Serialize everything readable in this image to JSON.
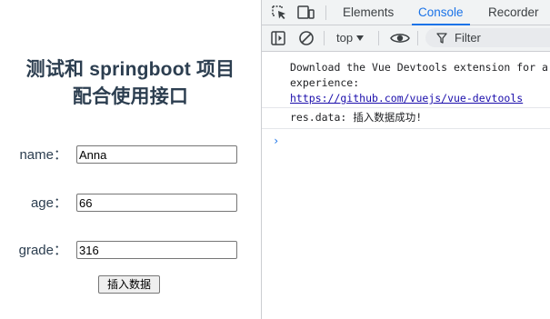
{
  "app": {
    "title_line1": "测试和 springboot 项目",
    "title_line2": "配合使用接口",
    "fields": [
      {
        "label": "name：",
        "value": "Anna"
      },
      {
        "label": "age：",
        "value": "66"
      },
      {
        "label": "grade：",
        "value": "316"
      }
    ],
    "submit_label": "插入数据"
  },
  "devtools": {
    "tabs": [
      {
        "label": "Elements",
        "active": false
      },
      {
        "label": "Console",
        "active": true
      },
      {
        "label": "Recorder",
        "active": false
      }
    ],
    "toolbar": {
      "context": "top",
      "filter_label": "Filter"
    },
    "console": {
      "messages": [
        {
          "line1": "Download the Vue Devtools extension for a",
          "line2": "experience:",
          "link": "https://github.com/vuejs/vue-devtools"
        },
        {
          "text": "res.data: 插入数据成功!"
        }
      ],
      "prompt_symbol": "›"
    },
    "colors": {
      "accent": "#1a73e8",
      "toolbar_bg": "#f1f3f4",
      "border": "#cbcdd1"
    }
  }
}
